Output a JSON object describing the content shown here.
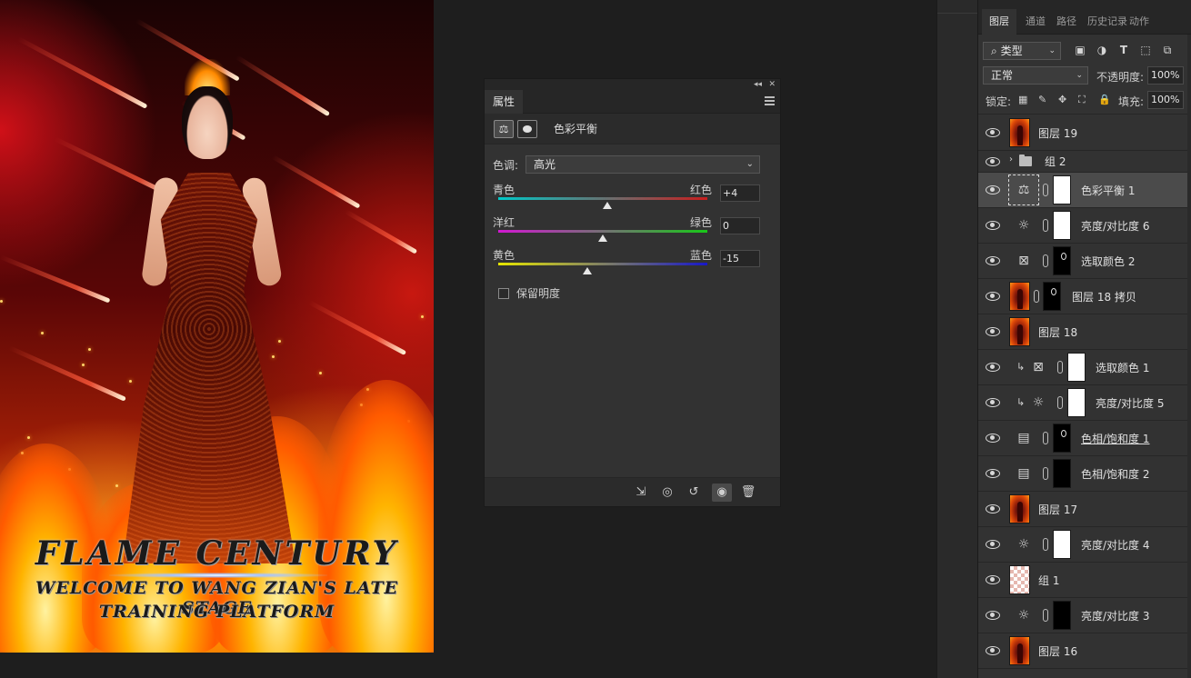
{
  "artwork": {
    "title": "FLAME CENTURY",
    "subtitle_line1": "WELCOME TO WANG ZIAN'S LATE STAGE",
    "subtitle_line2": "TRAINING PLATFORM"
  },
  "properties": {
    "tab": "属性",
    "title": "色彩平衡",
    "tone_label": "色调:",
    "tone_value": "高光",
    "sliders": [
      {
        "left": "青色",
        "right": "红色",
        "value": "+4",
        "level": 4,
        "gradient": "linear-gradient(90deg,#00c8c8,#c81e1e)"
      },
      {
        "left": "洋红",
        "right": "绿色",
        "value": "0",
        "level": 0,
        "gradient": "linear-gradient(90deg,#d218d2,#18c818)"
      },
      {
        "left": "黄色",
        "right": "蓝色",
        "value": "-15",
        "level": -15,
        "gradient": "linear-gradient(90deg,#e6e600,#1818c8)"
      }
    ],
    "preserve_label": "保留明度"
  },
  "layers": {
    "tabs": [
      "图层",
      "通道",
      "路径",
      "历史记录",
      "动作"
    ],
    "filter_kind": "类型",
    "blend_mode": "正常",
    "opacity_label": "不透明度:",
    "opacity_value": "100%",
    "lock_label": "锁定:",
    "fill_label": "填充:",
    "fill_value": "100%",
    "items": [
      {
        "name": "图层 19",
        "kind": "image"
      },
      {
        "name": "组 2",
        "kind": "group"
      },
      {
        "name": "色彩平衡 1",
        "kind": "adjust",
        "icon": "balance-icon",
        "mask": "white",
        "selected": true
      },
      {
        "name": "亮度/对比度 6",
        "kind": "adjust",
        "icon": "sun-icon",
        "mask": "white"
      },
      {
        "name": "选取颜色 2",
        "kind": "adjust",
        "icon": "selective-color-icon",
        "mask": "black-spot"
      },
      {
        "name": "图层 18 拷贝",
        "kind": "image-mask",
        "mask": "black-spot"
      },
      {
        "name": "图层 18",
        "kind": "image"
      },
      {
        "name": "选取颜色 1",
        "kind": "adjust",
        "icon": "selective-color-icon",
        "mask": "white",
        "clipped": true
      },
      {
        "name": "亮度/对比度 5",
        "kind": "adjust",
        "icon": "sun-icon",
        "mask": "white",
        "clipped": true
      },
      {
        "name": "色相/饱和度 1",
        "kind": "adjust",
        "icon": "hue-sat-icon",
        "mask": "black-spot",
        "underline": true
      },
      {
        "name": "色相/饱和度 2",
        "kind": "adjust",
        "icon": "hue-sat-icon",
        "mask": "black"
      },
      {
        "name": "图层 17",
        "kind": "image"
      },
      {
        "name": "亮度/对比度 4",
        "kind": "adjust",
        "icon": "sun-icon",
        "mask": "white"
      },
      {
        "name": "组 1",
        "kind": "checker"
      },
      {
        "name": "亮度/对比度 3",
        "kind": "adjust",
        "icon": "sun-icon",
        "mask": "black"
      },
      {
        "name": "图层 16",
        "kind": "image"
      }
    ]
  }
}
